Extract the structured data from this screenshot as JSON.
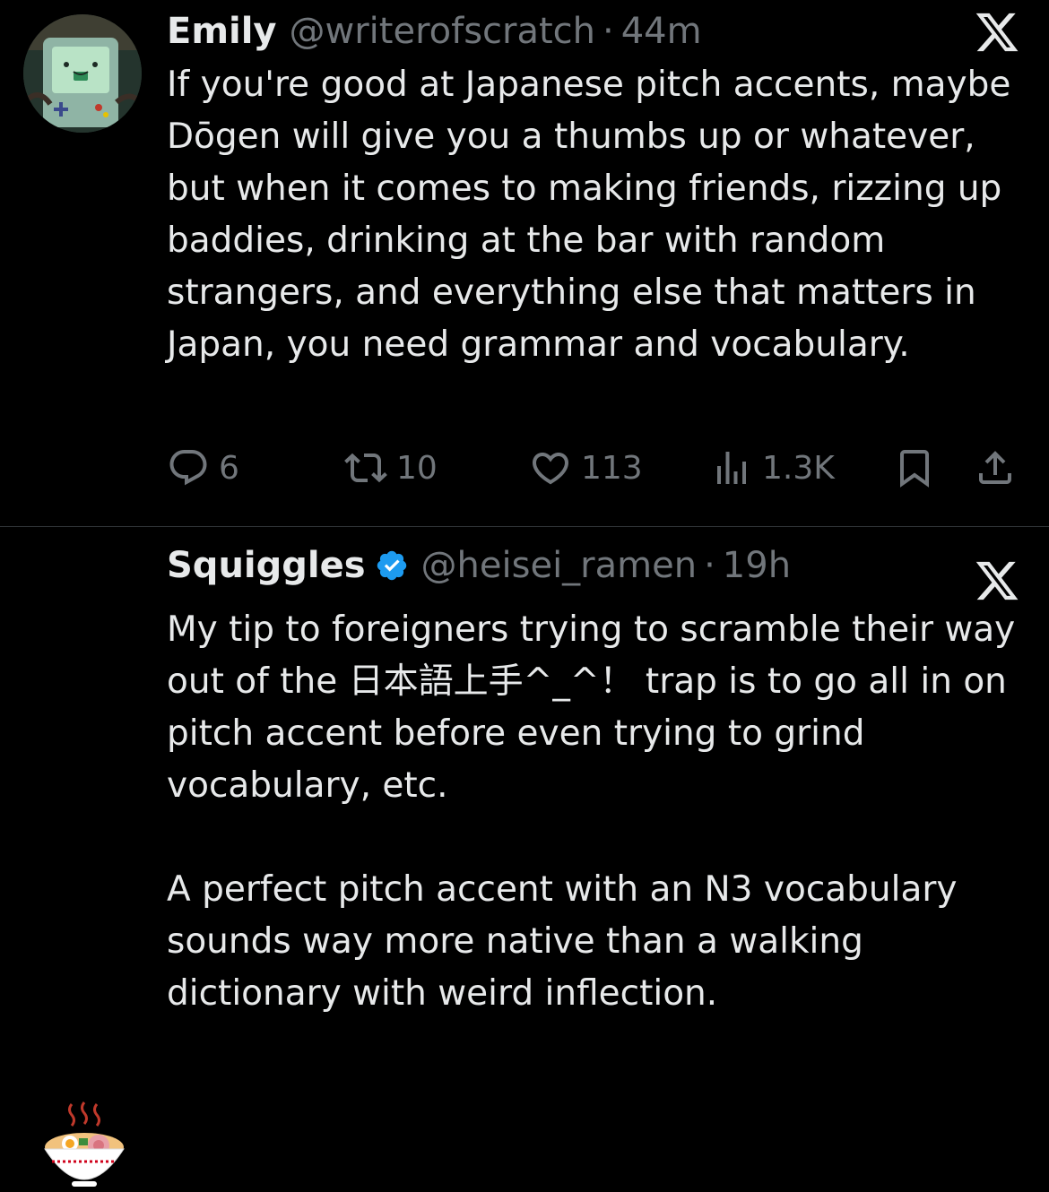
{
  "tweets": [
    {
      "name": "Emily",
      "handle": "@writerofscratch",
      "dot": "·",
      "time": "44m",
      "paragraphs": [
        "If you're good at Japanese pitch accents, maybe Dōgen will give you a thumbs up or whatever, but when it comes to making friends, rizzing up baddies, drinking at the bar with random strangers, and everything else that matters in Japan, you need grammar and vocabulary."
      ],
      "actions": {
        "replies": "6",
        "reposts": "10",
        "likes": "113",
        "views": "1.3K"
      }
    },
    {
      "name": "Squiggles",
      "handle": "@heisei_ramen",
      "dot": "·",
      "time": "19h",
      "verified": true,
      "paragraphs": [
        "My tip to foreigners trying to scramble their way out of the 日本語上手^_^！ trap is to go all in on pitch accent before even trying to grind vocabulary, etc.",
        "A perfect pitch accent with an N3 vocabulary sounds way more native than a walking dictionary with weird inflection."
      ]
    }
  ],
  "icons": {
    "avatar1": "bmo-game-console-avatar",
    "avatar2": "ramen-bowl-emoji-avatar",
    "close": "x-logo-icon",
    "reply": "reply-icon",
    "repost": "repost-icon",
    "like": "heart-icon",
    "views": "views-icon",
    "bookmark": "bookmark-icon",
    "share": "share-icon"
  },
  "colors": {
    "background": "#000000",
    "text": "#e7e9ea",
    "muted": "#71767b",
    "verified": "#1d9bf0",
    "divider": "#2f3336"
  }
}
